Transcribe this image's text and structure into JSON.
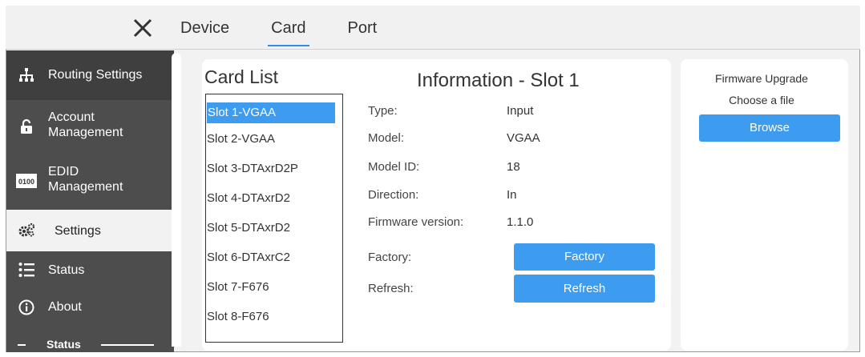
{
  "topbar": {
    "tabs": [
      {
        "label": "Device",
        "active": false
      },
      {
        "label": "Card",
        "active": true
      },
      {
        "label": "Port",
        "active": false
      }
    ],
    "close_icon": "close-icon"
  },
  "sidebar": {
    "items": [
      {
        "label": "Routing Settings",
        "icon": "network-icon"
      },
      {
        "label": "Account\nManagement",
        "icon": "lock-icon"
      },
      {
        "label": "EDID\nManagement",
        "icon": "edid-icon"
      },
      {
        "label": "Settings",
        "icon": "gears-icon",
        "active": true
      },
      {
        "label": "Status",
        "icon": "list-icon"
      },
      {
        "label": "About",
        "icon": "info-icon"
      }
    ],
    "section_label": "Status"
  },
  "card_list": {
    "title": "Card List",
    "slots": [
      "Slot 1-VGAA",
      "Slot 2-VGAA",
      "Slot 3-DTAxrD2P",
      "Slot 4-DTAxrD2",
      "Slot 5-DTAxrD2",
      "Slot 6-DTAxrC2",
      "Slot 7-F676",
      "Slot 8-F676"
    ],
    "selected_index": 0
  },
  "info": {
    "title": "Information - Slot 1",
    "rows": [
      {
        "label": "Type:",
        "value": "Input"
      },
      {
        "label": "Model:",
        "value": "VGAA"
      },
      {
        "label": "Model ID:",
        "value": "18"
      },
      {
        "label": "Direction:",
        "value": "In"
      },
      {
        "label": "Firmware version:",
        "value": "1.1.0"
      }
    ],
    "factory_label": "Factory:",
    "factory_button": "Factory",
    "refresh_label": "Refresh:",
    "refresh_button": "Refresh"
  },
  "firmware": {
    "title": "Firmware Upgrade",
    "subtitle": "Choose a file",
    "browse_button": "Browse"
  },
  "colors": {
    "accent": "#3d9bf0",
    "sidebar_bg": "#4d4d4d",
    "frame_bg": "#f2f2f2"
  }
}
